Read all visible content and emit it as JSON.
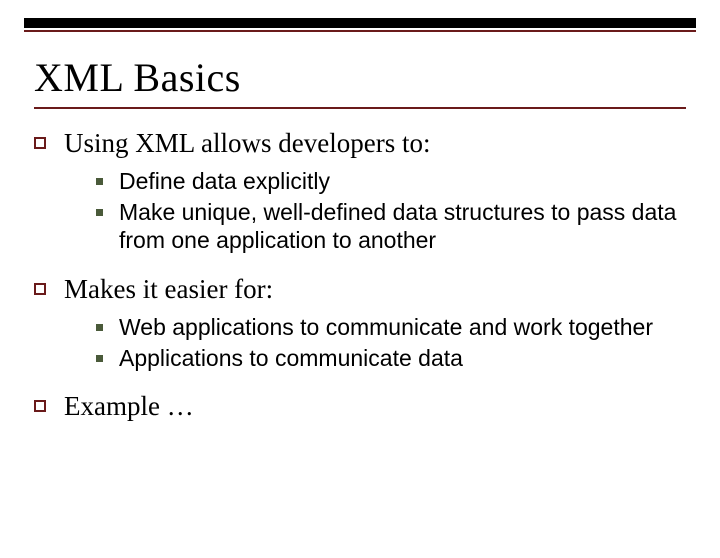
{
  "title": "XML Basics",
  "items": [
    {
      "text": "Using XML allows developers to:",
      "sub": [
        "Define data explicitly",
        "Make unique, well-defined data structures to pass data from one application to another"
      ]
    },
    {
      "text": "Makes it easier for:",
      "sub": [
        "Web applications to communicate and work together",
        "Applications to communicate data"
      ]
    },
    {
      "text": "Example …",
      "sub": []
    }
  ]
}
